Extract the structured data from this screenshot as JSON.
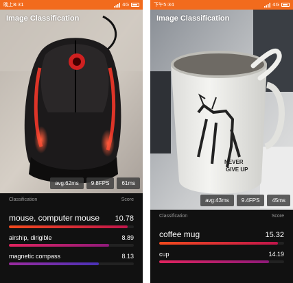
{
  "left": {
    "status": {
      "time": "晚上8:31",
      "network": "4G"
    },
    "title": "Image Classification",
    "stats": {
      "avg": "avg:62ms",
      "fps": "9.8FPS",
      "last": "61ms"
    },
    "results_header": {
      "label": "Classification",
      "score": "Score"
    },
    "results": [
      {
        "label": "mouse, computer mouse",
        "score": "10.78",
        "fill": 0.95,
        "color_from": "#f24a1d",
        "color_to": "#c0154b"
      },
      {
        "label": "airship, dirigible",
        "score": "8.89",
        "fill": 0.8,
        "color_from": "#e0245e",
        "color_to": "#8e1a7a"
      },
      {
        "label": "magnetic compass",
        "score": "8.13",
        "fill": 0.72,
        "color_from": "#9a2a9e",
        "color_to": "#4a32b8"
      }
    ]
  },
  "right": {
    "status": {
      "time": "下午5:34",
      "network": "4G"
    },
    "title": "Image Classification",
    "stats": {
      "avg": "avg:43ms",
      "fps": "9.4FPS",
      "last": "45ms"
    },
    "results_header": {
      "label": "Classification",
      "score": "Score"
    },
    "results": [
      {
        "label": "coffee mug",
        "score": "15.32",
        "fill": 0.95,
        "color_from": "#f24a1d",
        "color_to": "#c0154b"
      },
      {
        "label": "cup",
        "score": "14.19",
        "fill": 0.88,
        "color_from": "#e0245e",
        "color_to": "#8e1a7a"
      }
    ]
  },
  "colors": {
    "status_bar": "#f26b1d",
    "panel": "#111111"
  }
}
